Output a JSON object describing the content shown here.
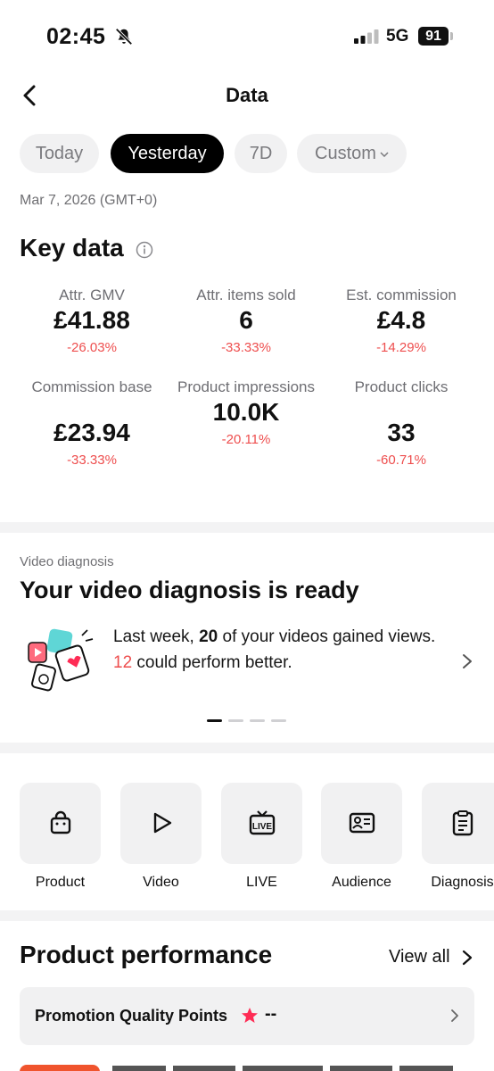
{
  "status_bar": {
    "time": "02:45",
    "network": "5G",
    "battery": "91"
  },
  "header": {
    "title": "Data"
  },
  "tabs": [
    {
      "label": "Today",
      "active": false
    },
    {
      "label": "Yesterday",
      "active": true
    },
    {
      "label": "7D",
      "active": false
    },
    {
      "label": "Custom",
      "active": false
    }
  ],
  "date_range": "Mar 7, 2026 (GMT+0)",
  "key_data": {
    "title": "Key data",
    "metrics": [
      {
        "label": "Attr. GMV",
        "value": "£41.88",
        "change": "-26.03%"
      },
      {
        "label": "Attr. items sold",
        "value": "6",
        "change": "-33.33%"
      },
      {
        "label": "Est. commission",
        "value": "£4.8",
        "change": "-14.29%"
      },
      {
        "label": "Commission base",
        "value": "£23.94",
        "change": "-33.33%"
      },
      {
        "label": "Product impressions",
        "value": "10.0K",
        "change": "-20.11%"
      },
      {
        "label": "Product clicks",
        "value": "33",
        "change": "-60.71%"
      }
    ]
  },
  "video_diagnosis": {
    "eyebrow": "Video diagnosis",
    "title": "Your video diagnosis is ready",
    "text_part1": "Last week, ",
    "count_gained": "20",
    "text_part2": " of your videos gained views. ",
    "count_better": "12",
    "text_part3": " could perform better.",
    "pager_active_index": 0,
    "pager_count": 4
  },
  "shortcuts": [
    {
      "label": "Product",
      "icon": "shopping-bag-icon"
    },
    {
      "label": "Video",
      "icon": "play-icon"
    },
    {
      "label": "LIVE",
      "icon": "live-tv-icon"
    },
    {
      "label": "Audience",
      "icon": "id-card-icon"
    },
    {
      "label": "Diagnosis",
      "icon": "clipboard-icon"
    }
  ],
  "product_performance": {
    "title": "Product performance",
    "view_all": "View all",
    "quality_points_label": "Promotion Quality Points",
    "quality_points_value": "--"
  },
  "colors": {
    "accent_red": "#ee4e4e",
    "star_red": "#fe2c55",
    "chip_bg": "#f1f1f2",
    "active_chip": "#000000"
  }
}
